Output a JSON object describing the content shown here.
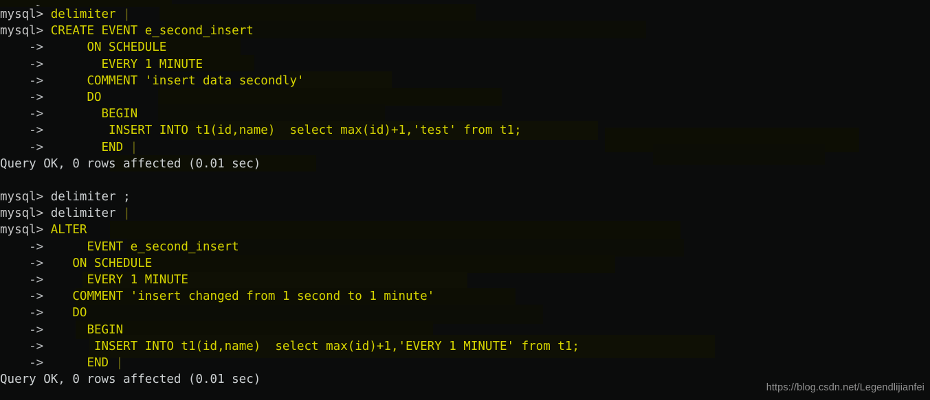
{
  "terminal": {
    "background_color": "#0b0c0c",
    "prompt_color": "#c6c6c6",
    "command_color": "#d6d400",
    "output_color": "#cdd1d3",
    "prompt_text": "mysql>",
    "continuation_text": "    ->",
    "cut_off_top_line": "    ->",
    "lines": [
      {
        "id": 0,
        "prefix": "mysql> ",
        "prefix_style": "prompt",
        "text": "delimiter ",
        "text_style": "cmd",
        "cursor": "|"
      },
      {
        "id": 1,
        "prefix": "mysql> ",
        "prefix_style": "prompt",
        "text": "CREATE EVENT e_second_insert",
        "text_style": "cmd",
        "cursor": ""
      },
      {
        "id": 2,
        "prefix": "    -> ",
        "prefix_style": "arrow",
        "text": "     ON SCHEDULE",
        "text_style": "cmd",
        "cursor": ""
      },
      {
        "id": 3,
        "prefix": "    -> ",
        "prefix_style": "arrow",
        "text": "       EVERY 1 MINUTE",
        "text_style": "cmd",
        "cursor": ""
      },
      {
        "id": 4,
        "prefix": "    -> ",
        "prefix_style": "arrow",
        "text": "     COMMENT 'insert data secondly'",
        "text_style": "cmd",
        "cursor": ""
      },
      {
        "id": 5,
        "prefix": "    -> ",
        "prefix_style": "arrow",
        "text": "     DO",
        "text_style": "cmd",
        "cursor": ""
      },
      {
        "id": 6,
        "prefix": "    -> ",
        "prefix_style": "arrow",
        "text": "       BEGIN",
        "text_style": "cmd",
        "cursor": ""
      },
      {
        "id": 7,
        "prefix": "    -> ",
        "prefix_style": "arrow",
        "text": "        INSERT INTO t1(id,name)  select max(id)+1,'test' from t1;",
        "text_style": "cmd",
        "cursor": ""
      },
      {
        "id": 8,
        "prefix": "    -> ",
        "prefix_style": "arrow",
        "text": "       END ",
        "text_style": "cmd",
        "cursor": "|"
      },
      {
        "id": 9,
        "prefix": "",
        "prefix_style": "result",
        "text": "Query OK, 0 rows affected (0.01 sec)",
        "text_style": "result",
        "cursor": ""
      },
      {
        "id": 10,
        "prefix": "",
        "prefix_style": "result",
        "text": "",
        "text_style": "result",
        "cursor": ""
      },
      {
        "id": 11,
        "prefix": "mysql> ",
        "prefix_style": "prompt",
        "text": "delimiter ;",
        "text_style": "plain",
        "cursor": ""
      },
      {
        "id": 12,
        "prefix": "mysql> ",
        "prefix_style": "prompt",
        "text": "delimiter ",
        "text_style": "plain",
        "cursor": "|"
      },
      {
        "id": 13,
        "prefix": "mysql> ",
        "prefix_style": "prompt",
        "text": "ALTER",
        "text_style": "cmd",
        "cursor": ""
      },
      {
        "id": 14,
        "prefix": "    -> ",
        "prefix_style": "arrow",
        "text": "     EVENT e_second_insert",
        "text_style": "cmd",
        "cursor": ""
      },
      {
        "id": 15,
        "prefix": "    -> ",
        "prefix_style": "arrow",
        "text": "   ON SCHEDULE",
        "text_style": "cmd",
        "cursor": ""
      },
      {
        "id": 16,
        "prefix": "    -> ",
        "prefix_style": "arrow",
        "text": "     EVERY 1 MINUTE",
        "text_style": "cmd",
        "cursor": ""
      },
      {
        "id": 17,
        "prefix": "    -> ",
        "prefix_style": "arrow",
        "text": "   COMMENT 'insert changed from 1 second to 1 minute'",
        "text_style": "cmd",
        "cursor": ""
      },
      {
        "id": 18,
        "prefix": "    -> ",
        "prefix_style": "arrow",
        "text": "   DO",
        "text_style": "cmd",
        "cursor": ""
      },
      {
        "id": 19,
        "prefix": "    -> ",
        "prefix_style": "arrow",
        "text": "     BEGIN",
        "text_style": "cmd",
        "cursor": ""
      },
      {
        "id": 20,
        "prefix": "    -> ",
        "prefix_style": "arrow",
        "text": "      INSERT INTO t1(id,name)  select max(id)+1,'EVERY 1 MINUTE' from t1;",
        "text_style": "cmd",
        "cursor": ""
      },
      {
        "id": 21,
        "prefix": "    -> ",
        "prefix_style": "arrow",
        "text": "     END ",
        "text_style": "cmd",
        "cursor": "|"
      },
      {
        "id": 22,
        "prefix": "",
        "prefix_style": "result",
        "text": "Query OK, 0 rows affected (0.01 sec)",
        "text_style": "result",
        "cursor": ""
      }
    ]
  },
  "watermark": {
    "text": "https://blog.csdn.net/Legendlijianfei",
    "color": "#9d9d9d"
  }
}
